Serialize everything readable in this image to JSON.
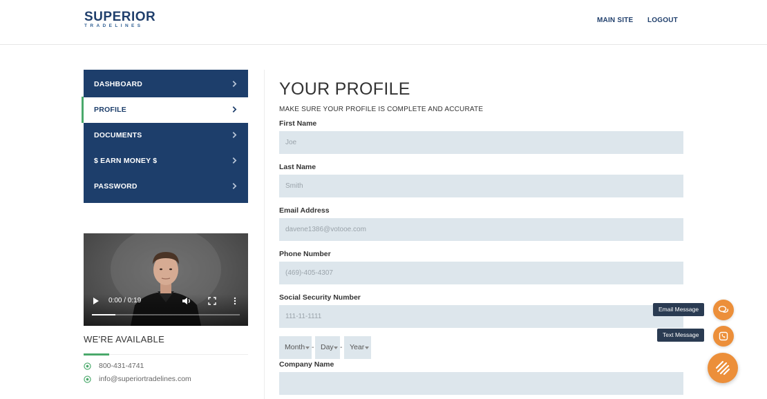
{
  "header": {
    "logo_top": "SUPERIOR",
    "logo_bottom": "TRADELINES",
    "nav": [
      "MAIN SITE",
      "LOGOUT"
    ]
  },
  "sidebar": {
    "items": [
      {
        "label": "DASHBOARD",
        "active": false
      },
      {
        "label": "PROFILE",
        "active": true
      },
      {
        "label": "DOCUMENTS",
        "active": false
      },
      {
        "label": "$ EARN MONEY $",
        "active": false
      },
      {
        "label": "PASSWORD",
        "active": false
      }
    ]
  },
  "video": {
    "time": "0:00 / 0:19",
    "progress": 0.16
  },
  "available": {
    "title": "WE'RE AVAILABLE",
    "phone": "800-431-4741",
    "email": "info@superiortradelines.com"
  },
  "main": {
    "title": "YOUR PROFILE",
    "subtitle": "MAKE SURE YOUR PROFILE IS COMPLETE AND ACCURATE",
    "fields": {
      "first_name": {
        "label": "First Name",
        "value": "Joe"
      },
      "last_name": {
        "label": "Last Name",
        "value": "Smith"
      },
      "email": {
        "label": "Email Address",
        "value": "davene1386@votooe.com"
      },
      "phone": {
        "label": "Phone Number",
        "value": "(469)-405-4307"
      },
      "ssn": {
        "label": "Social Security Number",
        "value": "111-11-1111"
      },
      "company": {
        "label": "Company Name",
        "value": ""
      }
    },
    "dob": {
      "month": "Month",
      "day": "Day",
      "year": "Year",
      "separator": "-"
    }
  },
  "floating": {
    "email_label": "Email Message",
    "text_label": "Text Message"
  },
  "colors": {
    "navy": "#1d3e6b",
    "green_accent": "#4aa96b",
    "orange": "#ec8f3a",
    "input_bg": "#dde6ec"
  }
}
